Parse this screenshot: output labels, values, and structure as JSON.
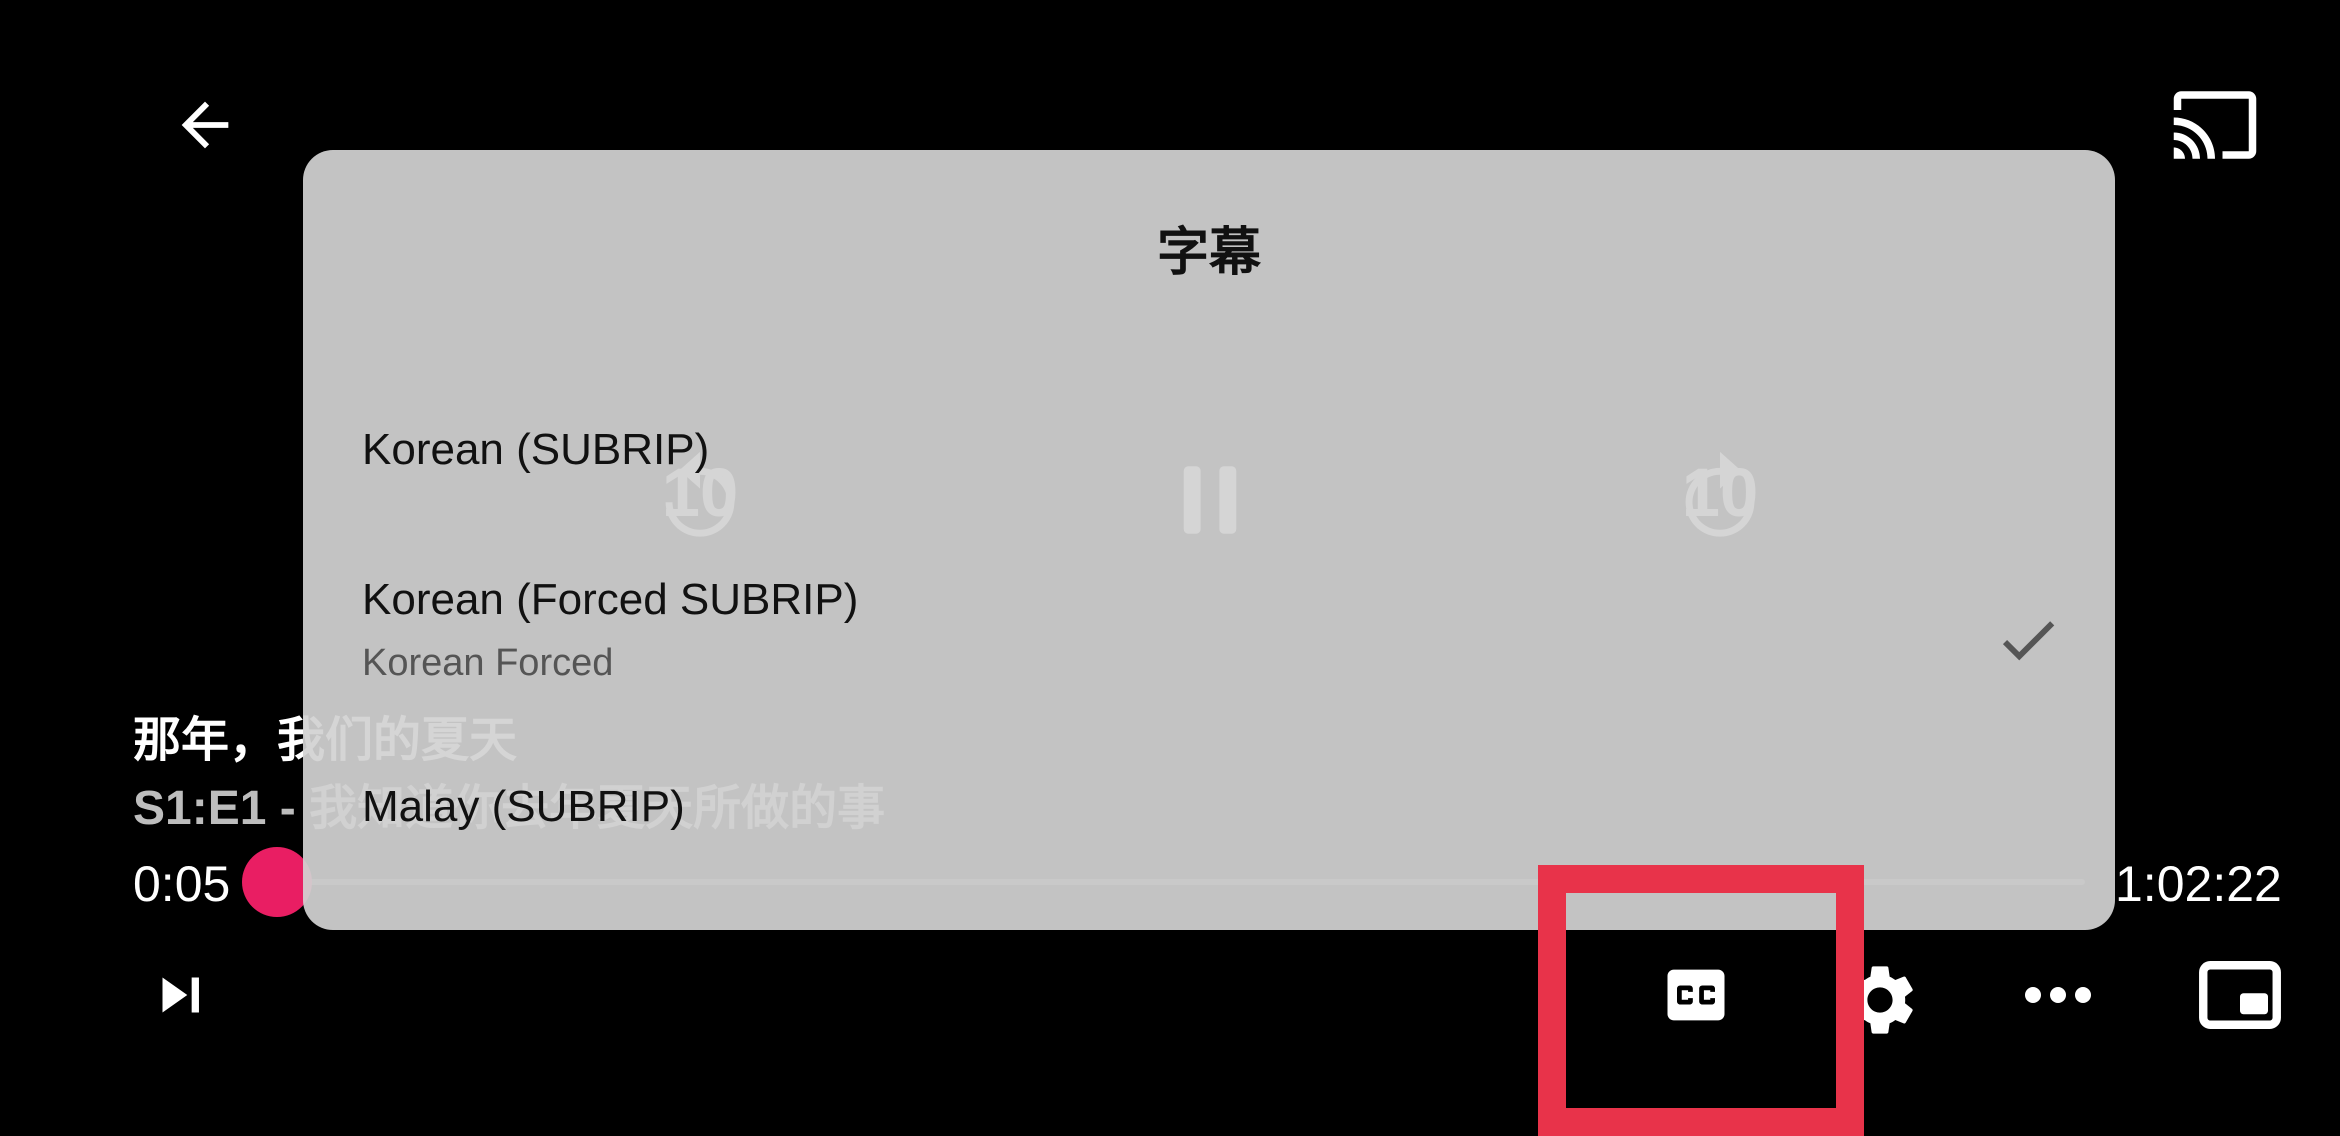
{
  "player": {
    "show_title": "那年，我们的夏天",
    "episode_line": "S1:E1 - 我知道你去年夏天所做的事",
    "time_elapsed": "0:05",
    "time_total": "1:02:22",
    "progress": 0.0013,
    "rewind_seconds": "10",
    "forward_seconds": "10"
  },
  "subtitle_sheet": {
    "title": "字幕",
    "tracks": [
      {
        "label": "Korean (SUBRIP)",
        "sublabel": "",
        "selected": false
      },
      {
        "label": "Korean (Forced SUBRIP)",
        "sublabel": "Korean Forced",
        "selected": true
      },
      {
        "label": "Malay (SUBRIP)",
        "sublabel": "",
        "selected": false
      }
    ]
  },
  "icons": {
    "back": "arrow-left-icon",
    "cast": "cast-icon",
    "rewind": "replay-10-icon",
    "pause": "pause-icon",
    "forward": "forward-10-icon",
    "next": "skip-next-icon",
    "cc": "closed-captions-icon",
    "settings": "gear-icon",
    "more": "more-horizontal-icon",
    "pip": "picture-in-picture-icon",
    "check": "check-icon"
  },
  "colors": {
    "accent": "#e91e63",
    "highlight": "#e8334a",
    "sheet_bg": "#d2d2d2",
    "background": "#000000"
  }
}
